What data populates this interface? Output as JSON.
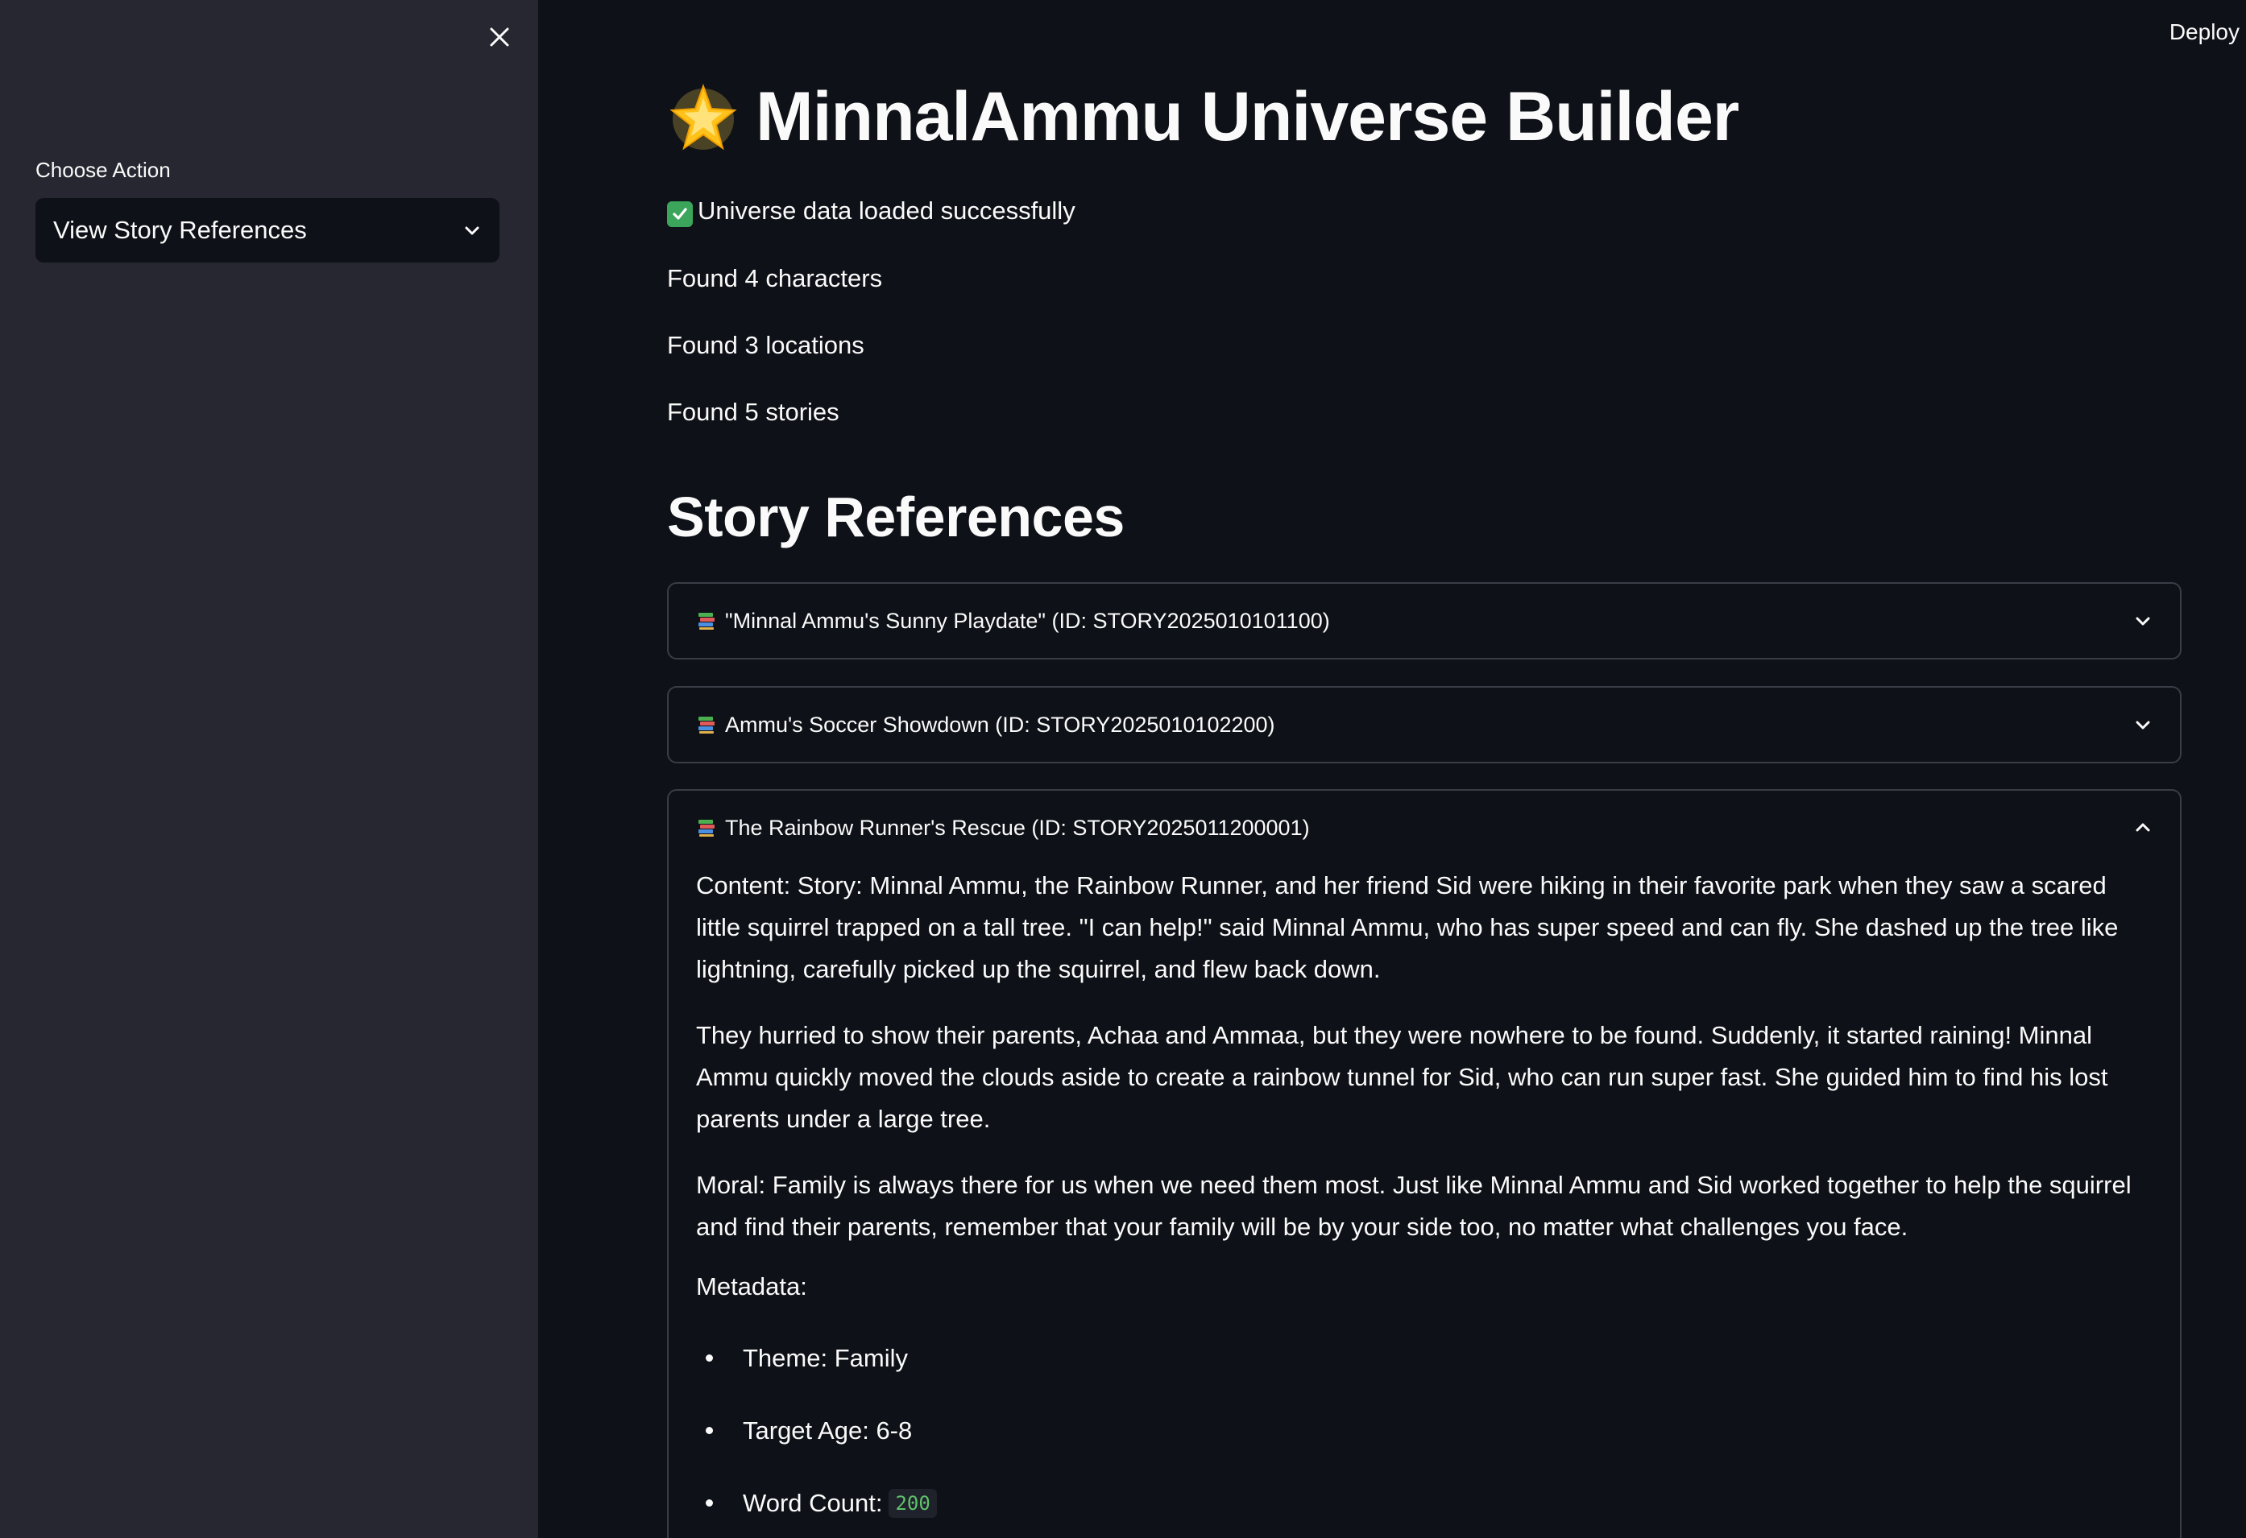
{
  "sidebar": {
    "label": "Choose Action",
    "select_value": "View Story References"
  },
  "header": {
    "deploy_label": "Deploy"
  },
  "main": {
    "title": "MinnalAmmu Universe Builder",
    "success_message": "Universe data loaded successfully",
    "stats": [
      "Found 4 characters",
      "Found 3 locations",
      "Found 5 stories"
    ],
    "section_title": "Story References",
    "stories": [
      {
        "title": "\"Minnal Ammu's Sunny Playdate\" (ID: STORY2025010101100)",
        "expanded": false
      },
      {
        "title": "Ammu's Soccer Showdown (ID: STORY2025010102200)",
        "expanded": false
      },
      {
        "title": "The Rainbow Runner's Rescue (ID: STORY2025011200001)",
        "expanded": true,
        "paragraphs": [
          "Content: Story: Minnal Ammu, the Rainbow Runner, and her friend Sid were hiking in their favorite park when they saw a scared little squirrel trapped on a tall tree. \"I can help!\" said Minnal Ammu, who has super speed and can fly. She dashed up the tree like lightning, carefully picked up the squirrel, and flew back down.",
          "They hurried to show their parents, Achaa and Ammaa, but they were nowhere to be found. Suddenly, it started raining! Minnal Ammu quickly moved the clouds aside to create a rainbow tunnel for Sid, who can run super fast. She guided him to find his lost parents under a large tree.",
          "Moral: Family is always there for us when we need them most. Just like Minnal Ammu and Sid worked together to help the squirrel and find their parents, remember that your family will be by your side too, no matter what challenges you face."
        ],
        "metadata_label": "Metadata:",
        "metadata": {
          "theme": "Theme: Family",
          "target_age": "Target Age: 6-8",
          "word_count_label": "Word Count:",
          "word_count_value": "200"
        }
      }
    ]
  },
  "colors": {
    "background": "#0e1117",
    "sidebar": "#262730",
    "border": "#3a3d46",
    "success_green": "#3ba55c",
    "code_green": "#5ec26b"
  }
}
